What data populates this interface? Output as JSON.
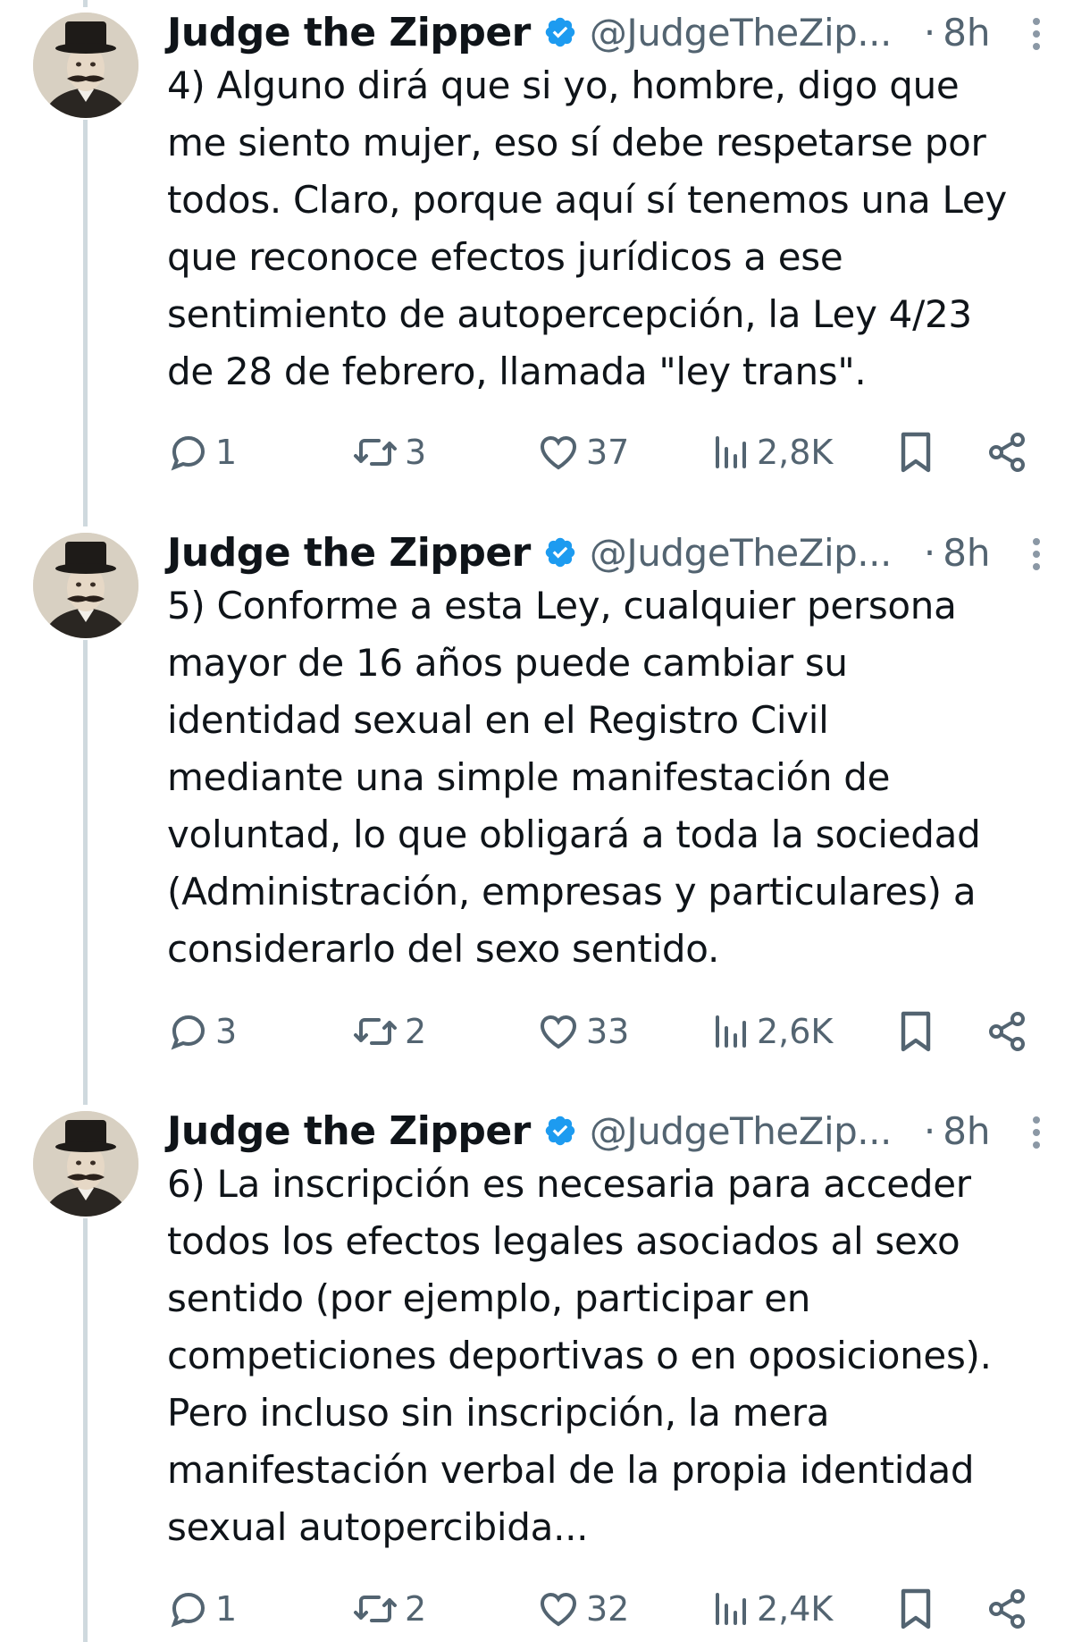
{
  "tweets": [
    {
      "author_name": "Judge the Zipper",
      "handle": "@JudgeTheZip...",
      "dot": "·",
      "time": "8h",
      "text": "4) Alguno dirá que si yo, hombre, digo que\nme siento mujer, eso sí debe respetarse por\ntodos. Claro, porque aquí sí tenemos una Ley\nque reconoce efectos jurídicos a ese\nsentimiento de autopercepción, la Ley 4/23\nde 28 de febrero, llamada \"ley trans\".",
      "replies": "1",
      "reposts": "3",
      "likes": "37",
      "views": "2,8K"
    },
    {
      "author_name": "Judge the Zipper",
      "handle": "@JudgeTheZip...",
      "dot": "·",
      "time": "8h",
      "text": "5) Conforme a esta Ley, cualquier persona\nmayor de 16 años puede cambiar su\nidentidad sexual en el Registro Civil\nmediante una simple manifestación de\nvoluntad, lo que obligará a toda la sociedad\n(Administración, empresas y particulares) a\nconsiderarlo del sexo sentido.",
      "replies": "3",
      "reposts": "2",
      "likes": "33",
      "views": "2,6K"
    },
    {
      "author_name": "Judge the Zipper",
      "handle": "@JudgeTheZip...",
      "dot": "·",
      "time": "8h",
      "text": "6) La inscripción es necesaria para acceder\ntodos los efectos legales asociados al sexo\nsentido (por ejemplo, participar en\ncompeticiones deportivas o en oposiciones).\nPero incluso sin inscripción, la mera\nmanifestación verbal de la propia identidad\nsexual autopercibida...",
      "replies": "1",
      "reposts": "2",
      "likes": "32",
      "views": "2,4K"
    }
  ],
  "icons": {
    "verified": "verified-badge-icon",
    "reply": "reply-bubble-icon",
    "repost": "repost-arrows-icon",
    "like": "heart-icon",
    "views": "bar-chart-icon",
    "bookmark": "bookmark-icon",
    "share": "share-icon",
    "more": "more-vertical-icon"
  },
  "colors": {
    "verified": "#1d9bf0",
    "secondary_text": "#536471",
    "thread_line": "#cfd9de"
  }
}
